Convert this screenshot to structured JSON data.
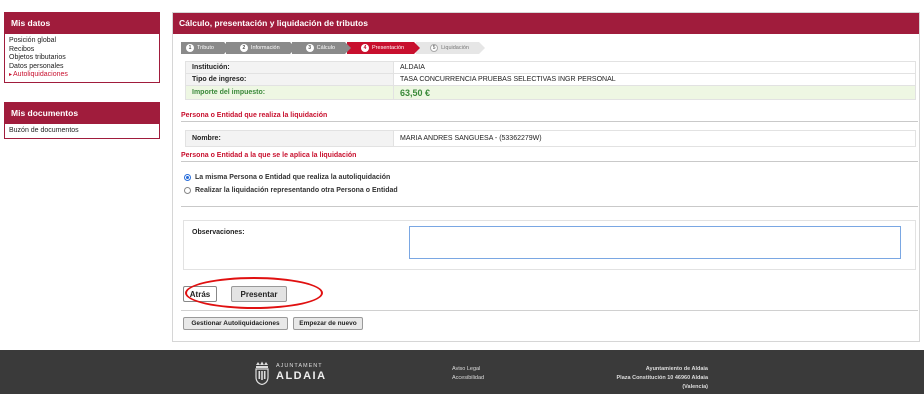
{
  "sidebar": {
    "datos_title": "Mis datos",
    "datos_items": [
      "Posición global",
      "Recibos",
      "Objetos tributarios",
      "Datos personales",
      "Autoliquidaciones"
    ],
    "docs_title": "Mis documentos",
    "docs_items": [
      "Buzón de documentos"
    ]
  },
  "main": {
    "title": "Cálculo, presentación y liquidación de tributos",
    "steps": [
      {
        "num": "1",
        "label": "Tributo"
      },
      {
        "num": "2",
        "label": "Información"
      },
      {
        "num": "3",
        "label": "Cálculo"
      },
      {
        "num": "4",
        "label": "Presentación"
      },
      {
        "num": "5",
        "label": "Liquidación"
      }
    ],
    "info": {
      "institucion_label": "Institución:",
      "institucion_value": "ALDAIA",
      "tipo_label": "Tipo de ingreso:",
      "tipo_value": "TASA CONCURRENCIA PRUEBAS SELECTIVAS INGR PERSONAL",
      "importe_label": "Importe del impuesto:",
      "importe_value": "63,50 €"
    },
    "realiza_title": "Persona o Entidad que realiza la liquidación",
    "nombre_label": "Nombre:",
    "nombre_value": "MARIA ANDRES SANGUESA - (53362279W)",
    "aplica_title": "Persona o Entidad a la que se le aplica la liquidación",
    "radio_options": [
      "La misma Persona o Entidad que realiza la autoliquidación",
      "Realizar la liquidación representando otra Persona o Entidad"
    ],
    "observaciones_label": "Observaciones:",
    "observaciones_value": "",
    "buttons": {
      "atras": "Atrás",
      "presentar": "Presentar",
      "gestionar": "Gestionar Autoliquidaciones",
      "empezar": "Empezar de nuevo"
    }
  },
  "footer": {
    "logo_small": "AJUNTAMENT",
    "logo_big": "ALDAIA",
    "links": [
      "Aviso Legal",
      "Accesibilidad"
    ],
    "address": [
      "Ayuntamiento de Aldaia",
      "Plaza Constitución 10 46960 Aldaia",
      "(Valencia)"
    ]
  },
  "colors": {
    "brand": "#a01c3c",
    "accent_red": "#c8102e",
    "importe_green": "#3a8a3a",
    "footer_bg": "#3a3a3a",
    "highlight": "#e01010"
  }
}
